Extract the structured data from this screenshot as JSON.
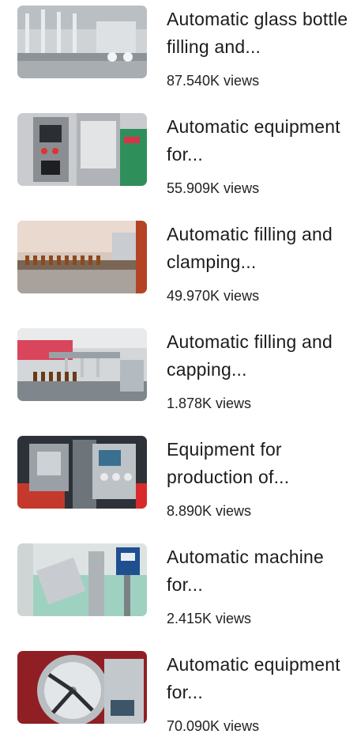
{
  "videos": [
    {
      "title": "Automatic glass bottle filling and...",
      "views": "87.540K views"
    },
    {
      "title": "Automatic equipment for...",
      "views": "55.909K views"
    },
    {
      "title": "Automatic filling and clamping...",
      "views": "49.970K views"
    },
    {
      "title": "Automatic filling and capping...",
      "views": "1.878K views"
    },
    {
      "title": "Equipment for production of...",
      "views": "8.890K views"
    },
    {
      "title": "Automatic machine for...",
      "views": "2.415K views"
    },
    {
      "title": "Automatic equipment for...",
      "views": "70.090K views"
    }
  ]
}
